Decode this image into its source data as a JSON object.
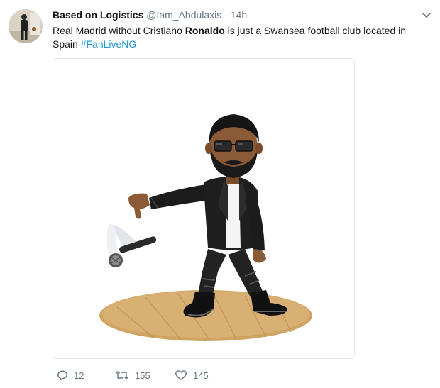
{
  "tweet": {
    "author_name": "Based on Logistics",
    "author_handle": "@Iam_Abdulaxis",
    "separator": "·",
    "time": "14h",
    "text_before": "Real Madrid without Cristiano ",
    "text_bold": "Ronaldo",
    "text_after": " is just a Swansea football club located in Spain ",
    "hashtag": "#FanLiveNG"
  },
  "actions": {
    "replies": "12",
    "retweets": "155",
    "likes": "145"
  },
  "colors": {
    "link": "#1b95e0",
    "secondary_text": "#657786",
    "border": "#e1e8ed"
  },
  "icons": [
    "chevron-down-icon",
    "reply-icon",
    "retweet-icon",
    "like-icon"
  ]
}
